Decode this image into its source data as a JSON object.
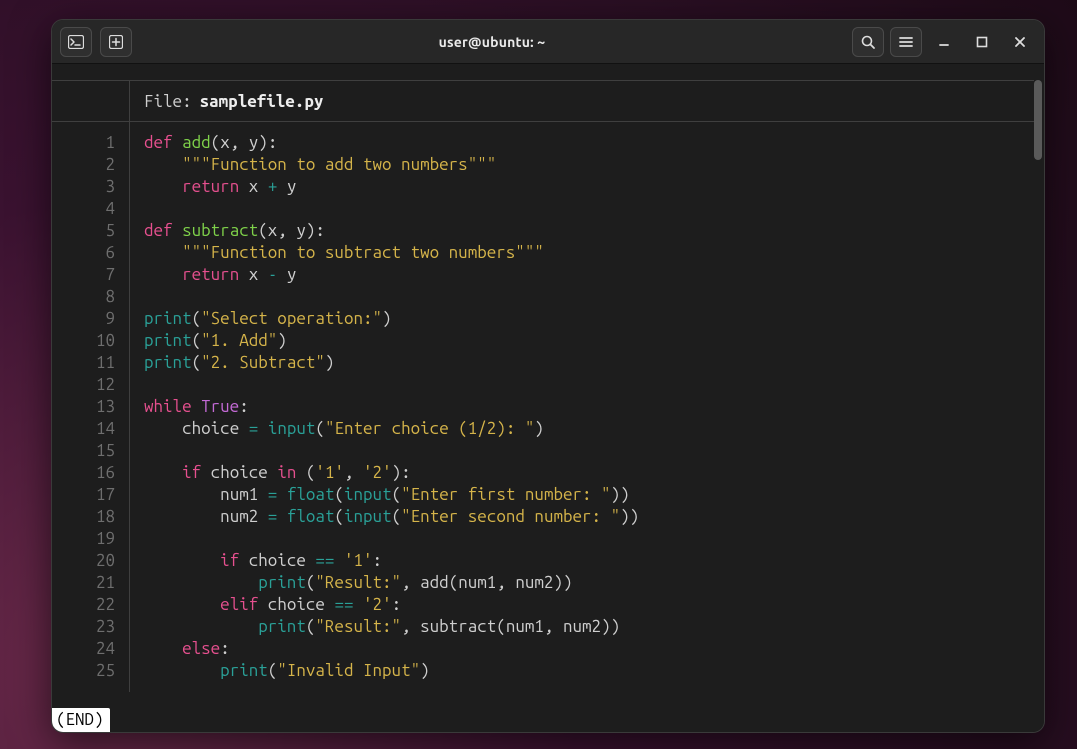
{
  "window": {
    "title": "user@ubuntu: ~"
  },
  "file": {
    "label": "File:",
    "name": "samplefile.py"
  },
  "footer": {
    "end": "(END)"
  },
  "icons": {
    "terminal": "terminal-icon",
    "new_tab": "plus-icon",
    "search": "search-icon",
    "menu": "hamburger-icon",
    "minimize": "minimize-icon",
    "maximize": "maximize-icon",
    "close": "close-icon"
  },
  "lines": [
    {
      "n": 1,
      "tokens": [
        [
          "kw",
          "def "
        ],
        [
          "fn",
          "add"
        ],
        [
          "pn",
          "("
        ],
        [
          "va",
          "x"
        ],
        [
          "pn",
          ", "
        ],
        [
          "va",
          "y"
        ],
        [
          "pn",
          "):"
        ]
      ]
    },
    {
      "n": 2,
      "tokens": [
        [
          "pn",
          "    "
        ],
        [
          "str",
          "\"\"\"Function to add two numbers\"\"\""
        ]
      ]
    },
    {
      "n": 3,
      "tokens": [
        [
          "pn",
          "    "
        ],
        [
          "kw",
          "return"
        ],
        [
          "pn",
          " "
        ],
        [
          "va",
          "x"
        ],
        [
          "pn",
          " "
        ],
        [
          "op",
          "+"
        ],
        [
          "pn",
          " "
        ],
        [
          "va",
          "y"
        ]
      ]
    },
    {
      "n": 4,
      "tokens": []
    },
    {
      "n": 5,
      "tokens": [
        [
          "kw",
          "def "
        ],
        [
          "fn",
          "subtract"
        ],
        [
          "pn",
          "("
        ],
        [
          "va",
          "x"
        ],
        [
          "pn",
          ", "
        ],
        [
          "va",
          "y"
        ],
        [
          "pn",
          "):"
        ]
      ]
    },
    {
      "n": 6,
      "tokens": [
        [
          "pn",
          "    "
        ],
        [
          "str",
          "\"\"\"Function to subtract two numbers\"\"\""
        ]
      ]
    },
    {
      "n": 7,
      "tokens": [
        [
          "pn",
          "    "
        ],
        [
          "kw",
          "return"
        ],
        [
          "pn",
          " "
        ],
        [
          "va",
          "x"
        ],
        [
          "pn",
          " "
        ],
        [
          "op",
          "-"
        ],
        [
          "pn",
          " "
        ],
        [
          "va",
          "y"
        ]
      ]
    },
    {
      "n": 8,
      "tokens": []
    },
    {
      "n": 9,
      "tokens": [
        [
          "bi",
          "print"
        ],
        [
          "pn",
          "("
        ],
        [
          "str",
          "\"Select operation:\""
        ],
        [
          "pn",
          ")"
        ]
      ]
    },
    {
      "n": 10,
      "tokens": [
        [
          "bi",
          "print"
        ],
        [
          "pn",
          "("
        ],
        [
          "str",
          "\"1. Add\""
        ],
        [
          "pn",
          ")"
        ]
      ]
    },
    {
      "n": 11,
      "tokens": [
        [
          "bi",
          "print"
        ],
        [
          "pn",
          "("
        ],
        [
          "str",
          "\"2. Subtract\""
        ],
        [
          "pn",
          ")"
        ]
      ]
    },
    {
      "n": 12,
      "tokens": []
    },
    {
      "n": 13,
      "tokens": [
        [
          "kw",
          "while "
        ],
        [
          "num",
          "True"
        ],
        [
          "pn",
          ":"
        ]
      ]
    },
    {
      "n": 14,
      "tokens": [
        [
          "pn",
          "    "
        ],
        [
          "va",
          "choice"
        ],
        [
          "pn",
          " "
        ],
        [
          "op",
          "="
        ],
        [
          "pn",
          " "
        ],
        [
          "bi",
          "input"
        ],
        [
          "pn",
          "("
        ],
        [
          "str",
          "\"Enter choice (1/2): \""
        ],
        [
          "pn",
          ")"
        ]
      ]
    },
    {
      "n": 15,
      "tokens": []
    },
    {
      "n": 16,
      "tokens": [
        [
          "pn",
          "    "
        ],
        [
          "kw",
          "if"
        ],
        [
          "pn",
          " "
        ],
        [
          "va",
          "choice"
        ],
        [
          "pn",
          " "
        ],
        [
          "kw",
          "in"
        ],
        [
          "pn",
          " ("
        ],
        [
          "str",
          "'1'"
        ],
        [
          "pn",
          ", "
        ],
        [
          "str",
          "'2'"
        ],
        [
          "pn",
          "):"
        ]
      ]
    },
    {
      "n": 17,
      "tokens": [
        [
          "pn",
          "        "
        ],
        [
          "va",
          "num1"
        ],
        [
          "pn",
          " "
        ],
        [
          "op",
          "="
        ],
        [
          "pn",
          " "
        ],
        [
          "bi",
          "float"
        ],
        [
          "pn",
          "("
        ],
        [
          "bi",
          "input"
        ],
        [
          "pn",
          "("
        ],
        [
          "str",
          "\"Enter first number: \""
        ],
        [
          "pn",
          "))"
        ]
      ]
    },
    {
      "n": 18,
      "tokens": [
        [
          "pn",
          "        "
        ],
        [
          "va",
          "num2"
        ],
        [
          "pn",
          " "
        ],
        [
          "op",
          "="
        ],
        [
          "pn",
          " "
        ],
        [
          "bi",
          "float"
        ],
        [
          "pn",
          "("
        ],
        [
          "bi",
          "input"
        ],
        [
          "pn",
          "("
        ],
        [
          "str",
          "\"Enter second number: \""
        ],
        [
          "pn",
          "))"
        ]
      ]
    },
    {
      "n": 19,
      "tokens": []
    },
    {
      "n": 20,
      "tokens": [
        [
          "pn",
          "        "
        ],
        [
          "kw",
          "if"
        ],
        [
          "pn",
          " "
        ],
        [
          "va",
          "choice"
        ],
        [
          "pn",
          " "
        ],
        [
          "op",
          "=="
        ],
        [
          "pn",
          " "
        ],
        [
          "str",
          "'1'"
        ],
        [
          "pn",
          ":"
        ]
      ]
    },
    {
      "n": 21,
      "tokens": [
        [
          "pn",
          "            "
        ],
        [
          "bi",
          "print"
        ],
        [
          "pn",
          "("
        ],
        [
          "str",
          "\"Result:\""
        ],
        [
          "pn",
          ", "
        ],
        [
          "va",
          "add"
        ],
        [
          "pn",
          "("
        ],
        [
          "va",
          "num1"
        ],
        [
          "pn",
          ", "
        ],
        [
          "va",
          "num2"
        ],
        [
          "pn",
          "))"
        ]
      ]
    },
    {
      "n": 22,
      "tokens": [
        [
          "pn",
          "        "
        ],
        [
          "kw",
          "elif"
        ],
        [
          "pn",
          " "
        ],
        [
          "va",
          "choice"
        ],
        [
          "pn",
          " "
        ],
        [
          "op",
          "=="
        ],
        [
          "pn",
          " "
        ],
        [
          "str",
          "'2'"
        ],
        [
          "pn",
          ":"
        ]
      ]
    },
    {
      "n": 23,
      "tokens": [
        [
          "pn",
          "            "
        ],
        [
          "bi",
          "print"
        ],
        [
          "pn",
          "("
        ],
        [
          "str",
          "\"Result:\""
        ],
        [
          "pn",
          ", "
        ],
        [
          "va",
          "subtract"
        ],
        [
          "pn",
          "("
        ],
        [
          "va",
          "num1"
        ],
        [
          "pn",
          ", "
        ],
        [
          "va",
          "num2"
        ],
        [
          "pn",
          "))"
        ]
      ]
    },
    {
      "n": 24,
      "tokens": [
        [
          "pn",
          "    "
        ],
        [
          "kw",
          "else"
        ],
        [
          "pn",
          ":"
        ]
      ]
    },
    {
      "n": 25,
      "tokens": [
        [
          "pn",
          "        "
        ],
        [
          "bi",
          "print"
        ],
        [
          "pn",
          "("
        ],
        [
          "str",
          "\"Invalid Input\""
        ],
        [
          "pn",
          ")"
        ]
      ]
    }
  ]
}
